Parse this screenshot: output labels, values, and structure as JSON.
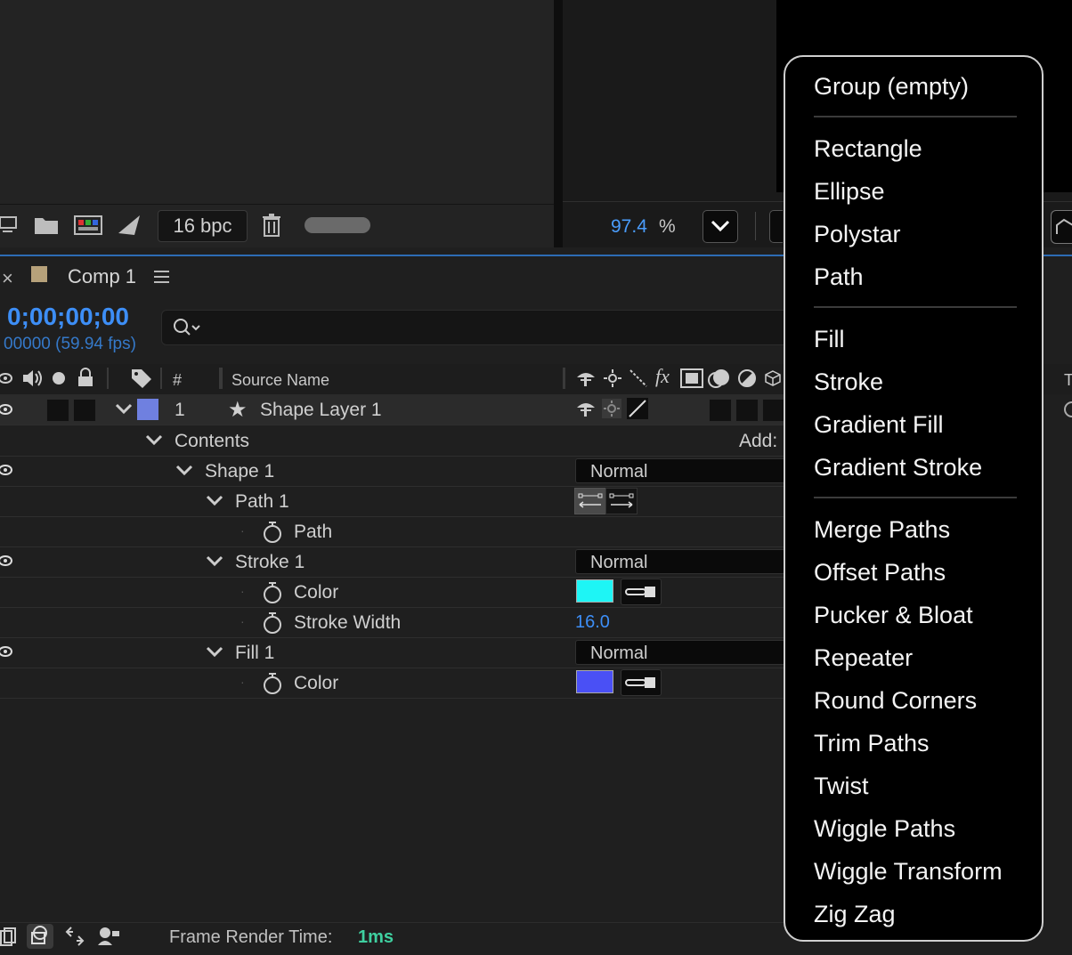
{
  "project": {
    "bpc": "16 bpc",
    "icons": [
      "interpret-footage-icon",
      "folder-icon",
      "composition-icon",
      "render-queue-icon",
      "trash-icon"
    ]
  },
  "viewer": {
    "zoom_value": "97.4",
    "zoom_unit": "%"
  },
  "timeline": {
    "tab_title": "Comp 1",
    "timecode": "0;00;00;00",
    "frame_info": "00000 (59.94 fps)",
    "columns": {
      "number": "#",
      "source_name": "Source Name"
    },
    "layer": {
      "index": "1",
      "name": "Shape Layer 1",
      "label_color": "#6f80e0"
    },
    "contents_label": "Contents",
    "add_label": "Add:",
    "rows": {
      "shape1": "Shape 1",
      "path1": "Path 1",
      "path": "Path",
      "stroke1": "Stroke 1",
      "stroke_color": "Color",
      "stroke_width": "Stroke Width",
      "stroke_width_value": "16.0",
      "fill1": "Fill 1",
      "fill_color": "Color"
    },
    "blend_modes": {
      "shape1": "Normal",
      "stroke1": "Normal",
      "fill1": "Normal"
    },
    "colors": {
      "stroke": "#1ef5f5",
      "fill": "#4a50f5"
    },
    "frame_render_label": "Frame Render Time:",
    "frame_render_value": "1ms"
  },
  "menu": {
    "items": [
      "Group (empty)",
      "Rectangle",
      "Ellipse",
      "Polystar",
      "Path",
      "Fill",
      "Stroke",
      "Gradient Fill",
      "Gradient Stroke",
      "Merge Paths",
      "Offset Paths",
      "Pucker & Bloat",
      "Repeater",
      "Round Corners",
      "Trim Paths",
      "Twist",
      "Wiggle Paths",
      "Wiggle Transform",
      "Zig Zag"
    ]
  }
}
